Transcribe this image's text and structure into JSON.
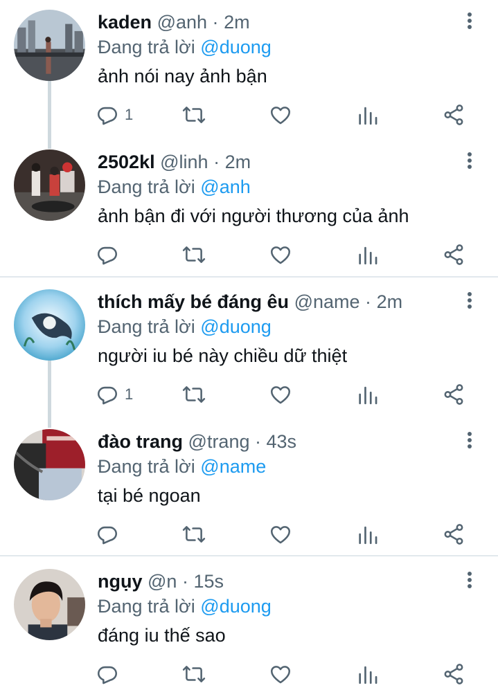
{
  "reply_prefix": "Đang trả lời",
  "separator": "·",
  "tweets": [
    {
      "name": "kaden",
      "handle": "@anh",
      "time": "2m",
      "reply_to": "@duong",
      "text": "ảnh nói nay ảnh bận",
      "reply_count": "1"
    },
    {
      "name": "2502kl",
      "handle": "@linh",
      "time": "2m",
      "reply_to": "@anh",
      "text": "ảnh bận đi với người thương của ảnh",
      "reply_count": ""
    },
    {
      "name": "thích mấy bé đáng êu",
      "handle": "@name",
      "time": "2m",
      "reply_to": "@duong",
      "text": "người iu bé này chiều dữ thiệt",
      "reply_count": "1"
    },
    {
      "name": "đào trang",
      "handle": "@trang",
      "time": "43s",
      "reply_to": "@name",
      "text": "tại bé ngoan",
      "reply_count": ""
    },
    {
      "name": "ngụy",
      "handle": "@n",
      "time": "15s",
      "reply_to": "@duong",
      "text": "đáng iu thế sao",
      "reply_count": ""
    }
  ],
  "colors": {
    "accent": "#1d9bf0",
    "muted": "#536471",
    "text": "#0f1419",
    "divider": "#e1e8ed",
    "thread": "#cfd9de"
  },
  "icons": [
    "reply-icon",
    "retweet-icon",
    "like-icon",
    "views-icon",
    "share-icon",
    "more-icon"
  ]
}
